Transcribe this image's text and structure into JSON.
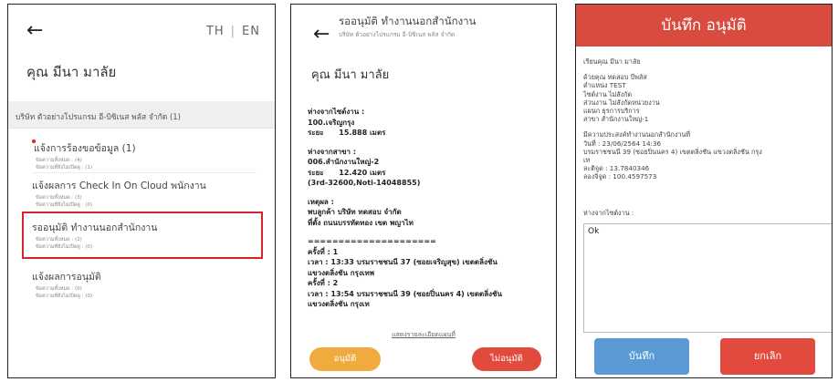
{
  "screen1": {
    "back_icon": "←",
    "lang_th": "TH",
    "lang_sep": "|",
    "lang_en": "EN",
    "user_name": "คุณ มีนา มาลัย",
    "company": "บริษัท ตัวอย่างโปรแกรม อี-บิซิเนส พลัส จำกัด  (1)",
    "menu": [
      {
        "title": "แจ้งการร้องขอข้อมูล (1)",
        "sub1": "ข้อความทั้งหมด : (4)",
        "sub2": "ข้อความที่ยังไม่เปิดดู : (1)",
        "unread": true
      },
      {
        "title": "แจ้งผลการ Check In On Cloud พนักงาน",
        "sub1": "ข้อความทั้งหมด : (3)",
        "sub2": "ข้อความที่ยังไม่เปิดดู : (0)",
        "unread": false
      },
      {
        "title": "รออนุมัติ ทำงานนอกสำนักงาน",
        "sub1": "ข้อความทั้งหมด : (2)",
        "sub2": "ข้อความที่ยังไม่เปิดดู : (0)",
        "unread": false
      },
      {
        "title": "แจ้งผลการอนุมัติ",
        "sub1": "ข้อความทั้งหมด : (0)",
        "sub2": "ข้อความที่ยังไม่เปิดดู : (0)",
        "unread": false
      }
    ],
    "highlight_color": "#d9232b"
  },
  "screen2": {
    "back_icon": "←",
    "title": "รออนุมัติ ทำงานนอกสำนักงาน",
    "subtitle": "บริษัท ตัวอย่างโปรแกรม อี-บิซิเนส พลัส จำกัด",
    "user_name": "คุณ มีนา มาลัย",
    "blocks": [
      [
        "ห่างจากไซต์งาน :",
        "100.เจริญกรุง",
        "ระยะ      15.888 เมตร"
      ],
      [
        "ห่างจากสาขา :",
        "006.สำนักงานใหญ่-2",
        "ระยะ      12.420 เมตร",
        "(3rd-32600,Noti-14048855)"
      ],
      [
        "เหตุผล :",
        "พบลูกค้า บริษัท ทดสอบ จำกัด",
        "ที่ตั้ง ถนนบรรทัดทอง เขต พญาไท"
      ],
      [
        "=====================",
        "ครั้งที่ : 1",
        "เวลา : 13:33 บรมราชชนนี 37 (ซอยเจริญสุข) เขตตลิ่งชัน",
        "แขวงตลิ่งชัน กรุงเทพ",
        "ครั้งที่ : 2",
        "เวลา : 13:54 บรมราชชนนี 39 (ซอยปิ่นนคร 4) เขตตลิ่งชัน",
        "แขวงตลิ่งชัน กรุงเท"
      ]
    ],
    "map_link": "แสดงรายละเอียดแผนที่",
    "approve_label": "อนุมัติ",
    "reject_label": "ไม่อนุมัติ",
    "approve_color": "#f0ab3e",
    "reject_color": "#e14a3c"
  },
  "screen3": {
    "header_title": "บันทึก อนุมัติ",
    "header_color": "#d94b3f",
    "blocks": [
      [
        "เรียนคุณ มีนา มาลัย"
      ],
      [
        "ด้วยคุณ ทดสอบ บีพลัส",
        "ตำแหน่ง TEST",
        "ไซต์งาน ไม่สังกัด",
        "ส่วนงาน ไม่สังกัดหน่วยงาน",
        "แผนก ธุรการบริการ",
        "สาขา สำนักงานใหญ่-1"
      ],
      [
        "มีความประสงค์ทำงานนอกสำนักงานที่",
        "วันที่ : 23/06/2564 14:36",
        "บรมราชชนนี 39 (ซอยปิ่นนคร 4) เขตตลิ่งชัน แขวงตลิ่งชัน กรุง",
        "เท",
        "ละติจูด : 13.7840346",
        "ลองจิจูด : 100.4597573"
      ]
    ],
    "remark_label": "ห่างจากไซต์งาน :",
    "remark_value": "Ok",
    "save_label": "บันทึก",
    "cancel_label": "ยกเลิก",
    "save_color": "#5a9bd5",
    "cancel_color": "#e14a3c"
  }
}
